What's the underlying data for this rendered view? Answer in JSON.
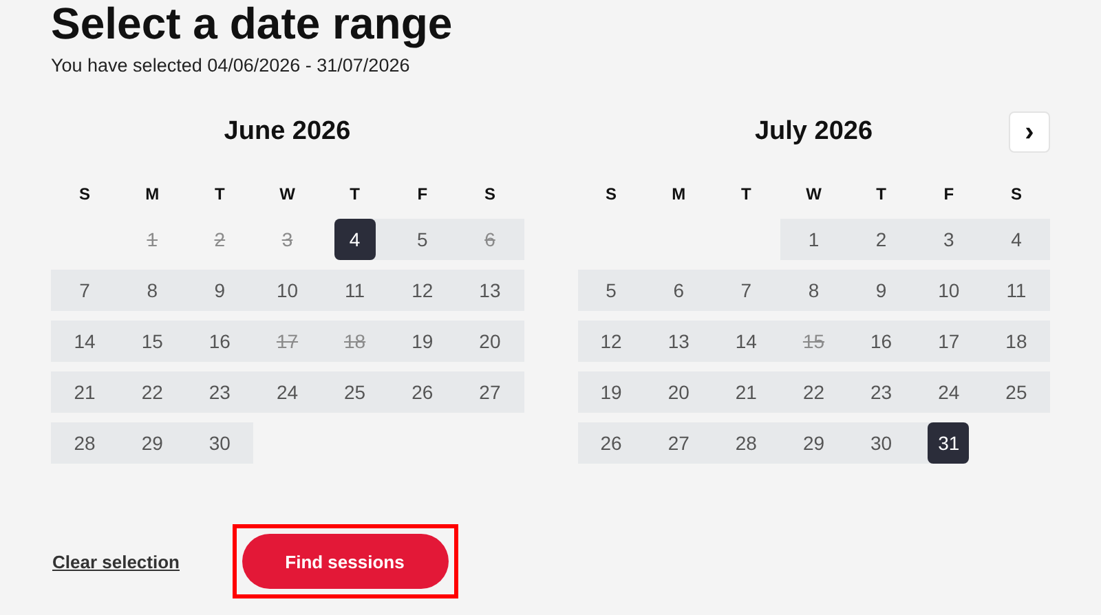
{
  "title": "Select a date range",
  "subtitle": "You have selected 04/06/2026 - 31/07/2026",
  "next_button": {
    "label": "›"
  },
  "calendars": [
    {
      "month": "June 2026",
      "weekdays": [
        "S",
        "M",
        "T",
        "W",
        "T",
        "F",
        "S"
      ],
      "weeks": [
        [
          {
            "kind": "blank"
          },
          {
            "day": "1",
            "in_range": false,
            "disabled": true,
            "selected": false
          },
          {
            "day": "2",
            "in_range": false,
            "disabled": true,
            "selected": false
          },
          {
            "day": "3",
            "in_range": false,
            "disabled": true,
            "selected": false
          },
          {
            "day": "4",
            "in_range": true,
            "disabled": false,
            "selected": true
          },
          {
            "day": "5",
            "in_range": true,
            "disabled": false,
            "selected": false
          },
          {
            "day": "6",
            "in_range": true,
            "disabled": true,
            "selected": false
          }
        ],
        [
          {
            "day": "7",
            "in_range": true,
            "disabled": false,
            "selected": false
          },
          {
            "day": "8",
            "in_range": true,
            "disabled": false,
            "selected": false
          },
          {
            "day": "9",
            "in_range": true,
            "disabled": false,
            "selected": false
          },
          {
            "day": "10",
            "in_range": true,
            "disabled": false,
            "selected": false
          },
          {
            "day": "11",
            "in_range": true,
            "disabled": false,
            "selected": false
          },
          {
            "day": "12",
            "in_range": true,
            "disabled": false,
            "selected": false
          },
          {
            "day": "13",
            "in_range": true,
            "disabled": false,
            "selected": false
          }
        ],
        [
          {
            "day": "14",
            "in_range": true,
            "disabled": false,
            "selected": false
          },
          {
            "day": "15",
            "in_range": true,
            "disabled": false,
            "selected": false
          },
          {
            "day": "16",
            "in_range": true,
            "disabled": false,
            "selected": false
          },
          {
            "day": "17",
            "in_range": true,
            "disabled": true,
            "selected": false
          },
          {
            "day": "18",
            "in_range": true,
            "disabled": true,
            "selected": false
          },
          {
            "day": "19",
            "in_range": true,
            "disabled": false,
            "selected": false
          },
          {
            "day": "20",
            "in_range": true,
            "disabled": false,
            "selected": false
          }
        ],
        [
          {
            "day": "21",
            "in_range": true,
            "disabled": false,
            "selected": false
          },
          {
            "day": "22",
            "in_range": true,
            "disabled": false,
            "selected": false
          },
          {
            "day": "23",
            "in_range": true,
            "disabled": false,
            "selected": false
          },
          {
            "day": "24",
            "in_range": true,
            "disabled": false,
            "selected": false
          },
          {
            "day": "25",
            "in_range": true,
            "disabled": false,
            "selected": false
          },
          {
            "day": "26",
            "in_range": true,
            "disabled": false,
            "selected": false
          },
          {
            "day": "27",
            "in_range": true,
            "disabled": false,
            "selected": false
          }
        ],
        [
          {
            "day": "28",
            "in_range": true,
            "disabled": false,
            "selected": false
          },
          {
            "day": "29",
            "in_range": true,
            "disabled": false,
            "selected": false
          },
          {
            "day": "30",
            "in_range": true,
            "disabled": false,
            "selected": false
          }
        ]
      ]
    },
    {
      "month": "July 2026",
      "weekdays": [
        "S",
        "M",
        "T",
        "W",
        "T",
        "F",
        "S"
      ],
      "weeks": [
        [
          {
            "kind": "blank"
          },
          {
            "kind": "blank"
          },
          {
            "kind": "blank"
          },
          {
            "day": "1",
            "in_range": true,
            "disabled": false,
            "selected": false
          },
          {
            "day": "2",
            "in_range": true,
            "disabled": false,
            "selected": false
          },
          {
            "day": "3",
            "in_range": true,
            "disabled": false,
            "selected": false
          },
          {
            "day": "4",
            "in_range": true,
            "disabled": false,
            "selected": false
          }
        ],
        [
          {
            "day": "5",
            "in_range": true,
            "disabled": false,
            "selected": false
          },
          {
            "day": "6",
            "in_range": true,
            "disabled": false,
            "selected": false
          },
          {
            "day": "7",
            "in_range": true,
            "disabled": false,
            "selected": false
          },
          {
            "day": "8",
            "in_range": true,
            "disabled": false,
            "selected": false
          },
          {
            "day": "9",
            "in_range": true,
            "disabled": false,
            "selected": false
          },
          {
            "day": "10",
            "in_range": true,
            "disabled": false,
            "selected": false
          },
          {
            "day": "11",
            "in_range": true,
            "disabled": false,
            "selected": false
          }
        ],
        [
          {
            "day": "12",
            "in_range": true,
            "disabled": false,
            "selected": false
          },
          {
            "day": "13",
            "in_range": true,
            "disabled": false,
            "selected": false
          },
          {
            "day": "14",
            "in_range": true,
            "disabled": false,
            "selected": false
          },
          {
            "day": "15",
            "in_range": true,
            "disabled": true,
            "selected": false
          },
          {
            "day": "16",
            "in_range": true,
            "disabled": false,
            "selected": false
          },
          {
            "day": "17",
            "in_range": true,
            "disabled": false,
            "selected": false
          },
          {
            "day": "18",
            "in_range": true,
            "disabled": false,
            "selected": false
          }
        ],
        [
          {
            "day": "19",
            "in_range": true,
            "disabled": false,
            "selected": false
          },
          {
            "day": "20",
            "in_range": true,
            "disabled": false,
            "selected": false
          },
          {
            "day": "21",
            "in_range": true,
            "disabled": false,
            "selected": false
          },
          {
            "day": "22",
            "in_range": true,
            "disabled": false,
            "selected": false
          },
          {
            "day": "23",
            "in_range": true,
            "disabled": false,
            "selected": false
          },
          {
            "day": "24",
            "in_range": true,
            "disabled": false,
            "selected": false
          },
          {
            "day": "25",
            "in_range": true,
            "disabled": false,
            "selected": false
          }
        ],
        [
          {
            "day": "26",
            "in_range": true,
            "disabled": false,
            "selected": false
          },
          {
            "day": "27",
            "in_range": true,
            "disabled": false,
            "selected": false
          },
          {
            "day": "28",
            "in_range": true,
            "disabled": false,
            "selected": false
          },
          {
            "day": "29",
            "in_range": true,
            "disabled": false,
            "selected": false
          },
          {
            "day": "30",
            "in_range": true,
            "disabled": false,
            "selected": false
          },
          {
            "day": "31",
            "in_range": true,
            "disabled": false,
            "selected": true
          }
        ]
      ]
    }
  ],
  "clear_link": "Clear selection",
  "find_button": {
    "label": "Find sessions",
    "highlighted": true
  }
}
